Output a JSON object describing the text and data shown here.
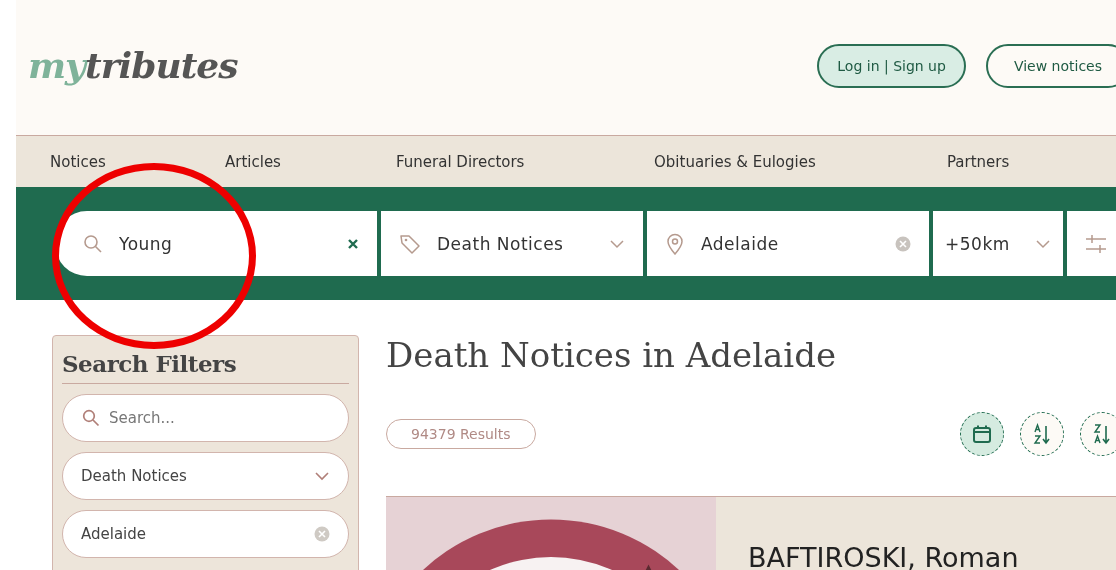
{
  "header": {
    "logo": {
      "prefix": "my",
      "rest": "tributes"
    },
    "buttons": [
      {
        "label": "Log in | Sign up",
        "kind": "primary"
      },
      {
        "label": "View notices",
        "kind": "outline"
      }
    ]
  },
  "nav": {
    "items": [
      "Notices",
      "Articles",
      "Funeral Directors",
      "Obituaries & Eulogies",
      "Partners"
    ]
  },
  "search_bar": {
    "keyword": {
      "value": "Young"
    },
    "category": {
      "value": "Death Notices"
    },
    "location": {
      "value": "Adelaide"
    },
    "distance": {
      "value": "+50km"
    }
  },
  "annotation": {
    "kind": "circle"
  },
  "filters": {
    "title": "Search Filters",
    "search": {
      "placeholder": "Search..."
    },
    "category": {
      "value": "Death Notices"
    },
    "location": {
      "value": "Adelaide"
    }
  },
  "results": {
    "title": "Death Notices in Adelaide",
    "count": "94379 Results",
    "sort_buttons": [
      {
        "kind": "date",
        "selected": true
      },
      {
        "kind": "az",
        "selected": false
      },
      {
        "kind": "za",
        "selected": false
      }
    ],
    "notices": [
      {
        "name": "BAFTIROSKI, Roman",
        "kind": "picture"
      }
    ]
  }
}
